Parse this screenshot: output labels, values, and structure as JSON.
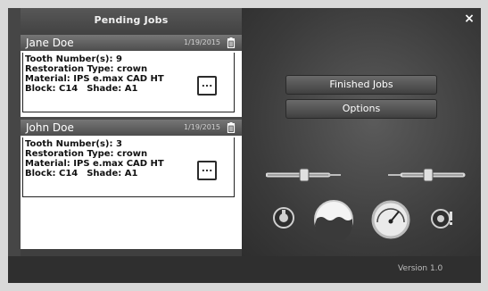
{
  "header": {
    "title": "Pending Jobs",
    "close_label": "×"
  },
  "jobs": [
    {
      "name": "Jane Doe",
      "date": "1/19/2015",
      "tooth": "Tooth Number(s): 9",
      "restoration": "Restoration Type: crown",
      "material": "Material: IPS e.max CAD HT",
      "block": "Block: C14",
      "shade": "Shade: A1",
      "more_label": "...",
      "icon": "trash-icon"
    },
    {
      "name": "John Doe",
      "date": "1/19/2015",
      "tooth": "Tooth Number(s): 3",
      "restoration": "Restoration Type: crown",
      "material": "Material: IPS e.max CAD HT",
      "block": "Block: C14",
      "shade": "Shade: A1",
      "more_label": "...",
      "icon": "trash-icon"
    }
  ],
  "menu": {
    "finished_jobs": "Finished Jobs",
    "options": "Options"
  },
  "tools": [
    {
      "name": "bur-tool-left-icon"
    },
    {
      "name": "bur-tool-right-icon"
    },
    {
      "name": "spindle-icon"
    },
    {
      "name": "water-tank-icon"
    },
    {
      "name": "pressure-gauge-icon"
    },
    {
      "name": "alert-sensor-icon"
    }
  ],
  "footer": {
    "version": "Version 1.0"
  },
  "colors": {
    "header_bg": "#4d4d4d",
    "panel_bg": "#ffffff",
    "right_bg": "#555555"
  }
}
